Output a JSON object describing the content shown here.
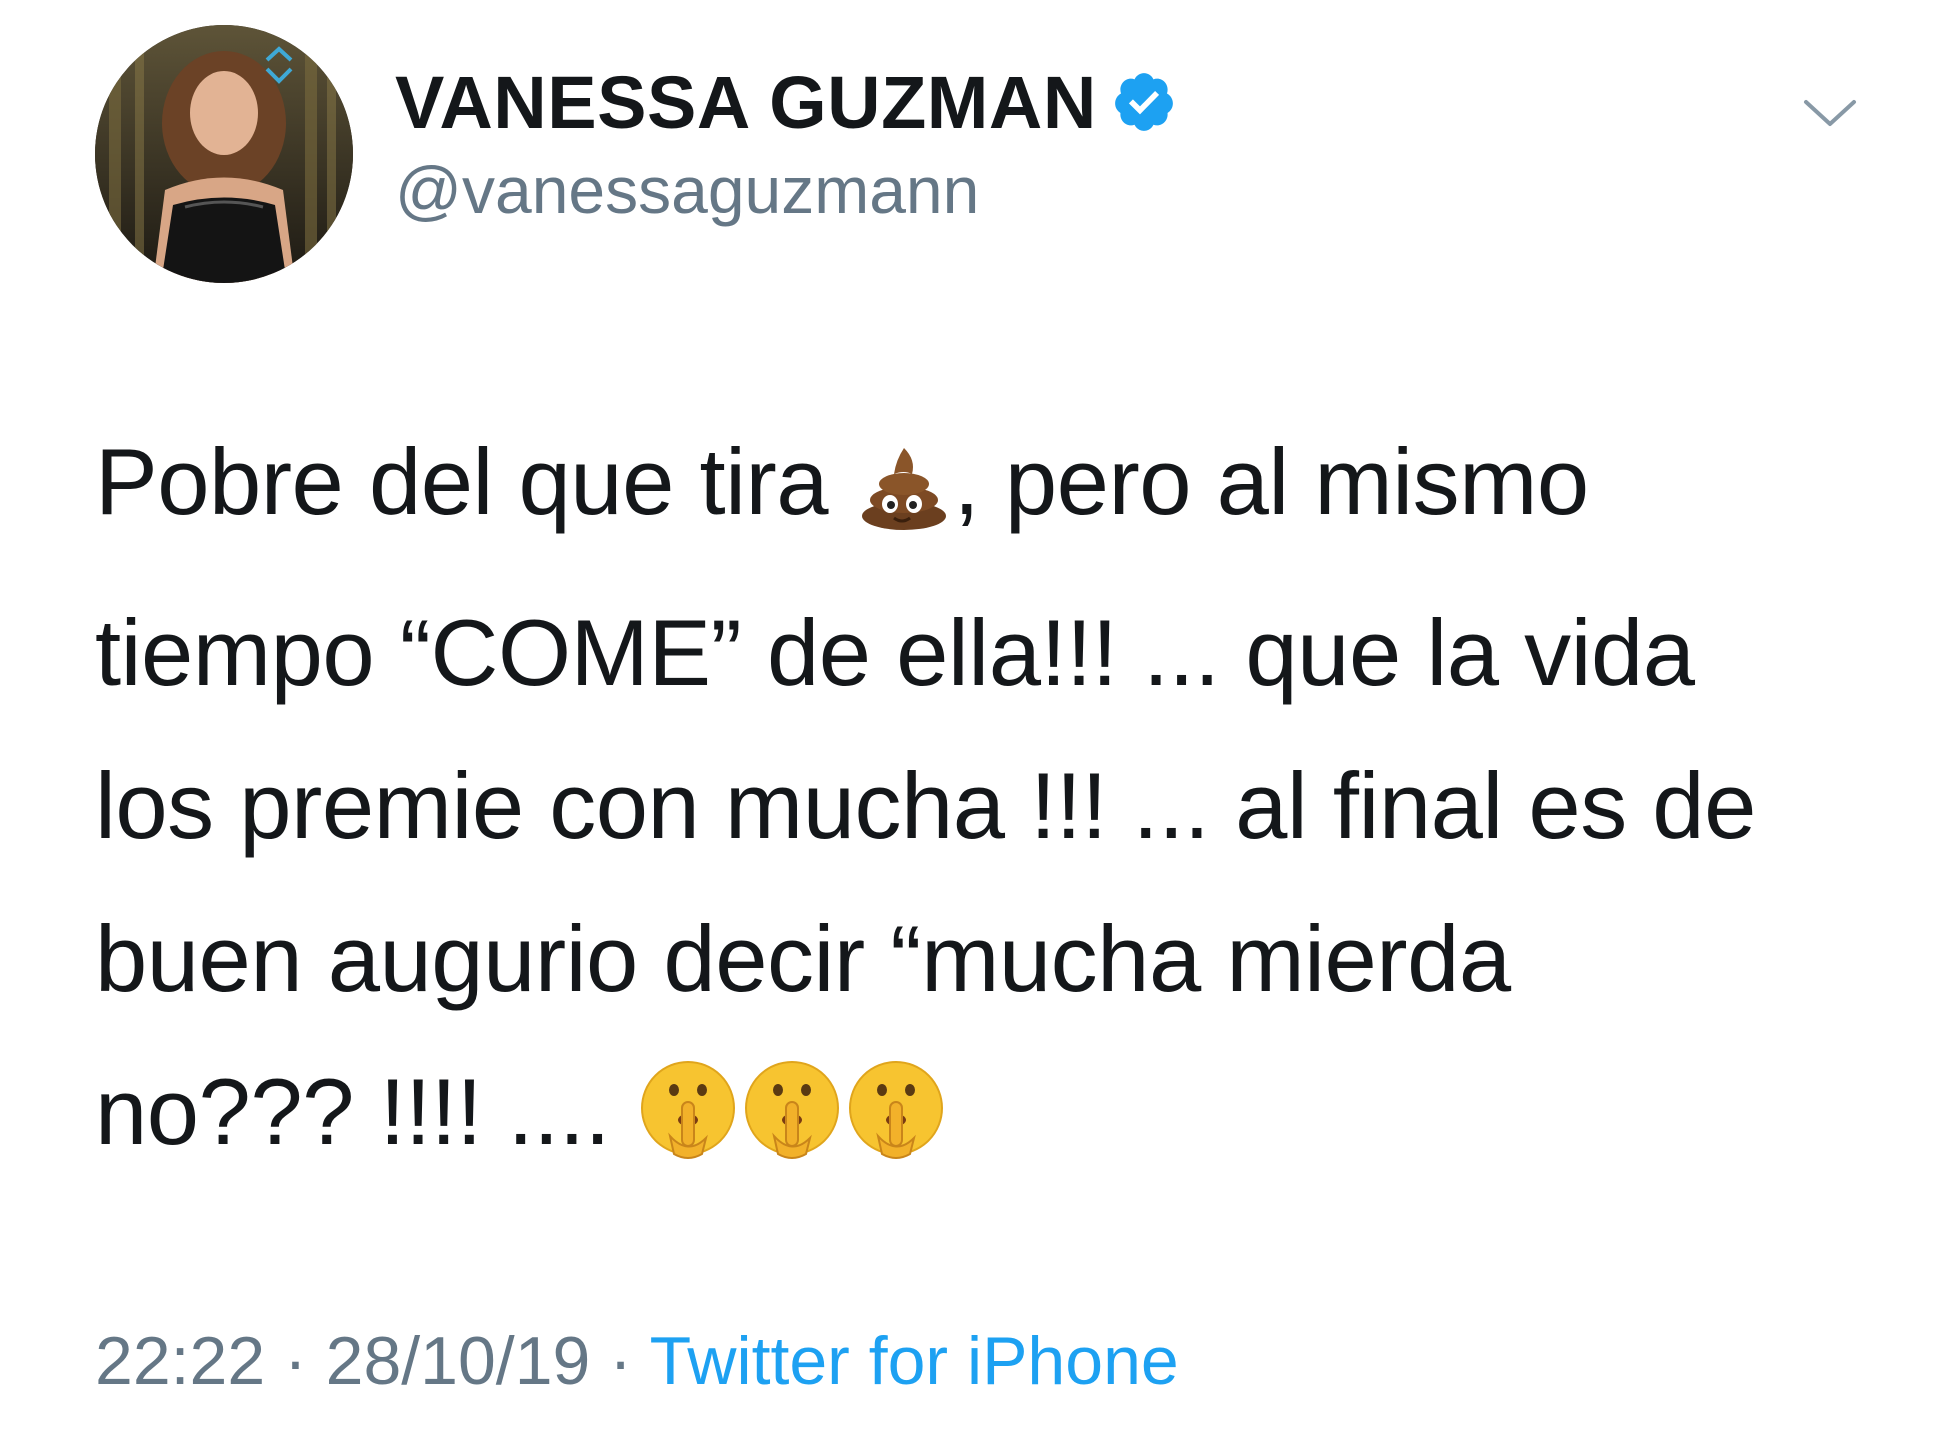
{
  "user": {
    "display_name": "VANESSA GUZMAN",
    "handle": "@vanessaguzmann",
    "verified": true,
    "avatar_icon": "profile-photo"
  },
  "menu": {
    "icon": "chevron-down-icon"
  },
  "tweet": {
    "line1_a": "Pobre del que tira ",
    "line1_b": ", pero al mismo",
    "line2": "tiempo “COME” de ella!!! ... que la vida",
    "line3": "los premie con mucha !!! ... al final es de",
    "line4": "buen augurio decir “mucha mierda",
    "line5": "no??? !!!! .... ",
    "emojis": [
      "poop-emoji",
      "shushing-face-emoji",
      "shushing-face-emoji",
      "shushing-face-emoji"
    ]
  },
  "meta": {
    "time": "22:22",
    "separator": "·",
    "date": "28/10/19",
    "source": "Twitter for iPhone"
  },
  "colors": {
    "text": "#14171a",
    "secondary": "#657786",
    "link": "#1da1f2",
    "verified": "#1da1f2"
  }
}
